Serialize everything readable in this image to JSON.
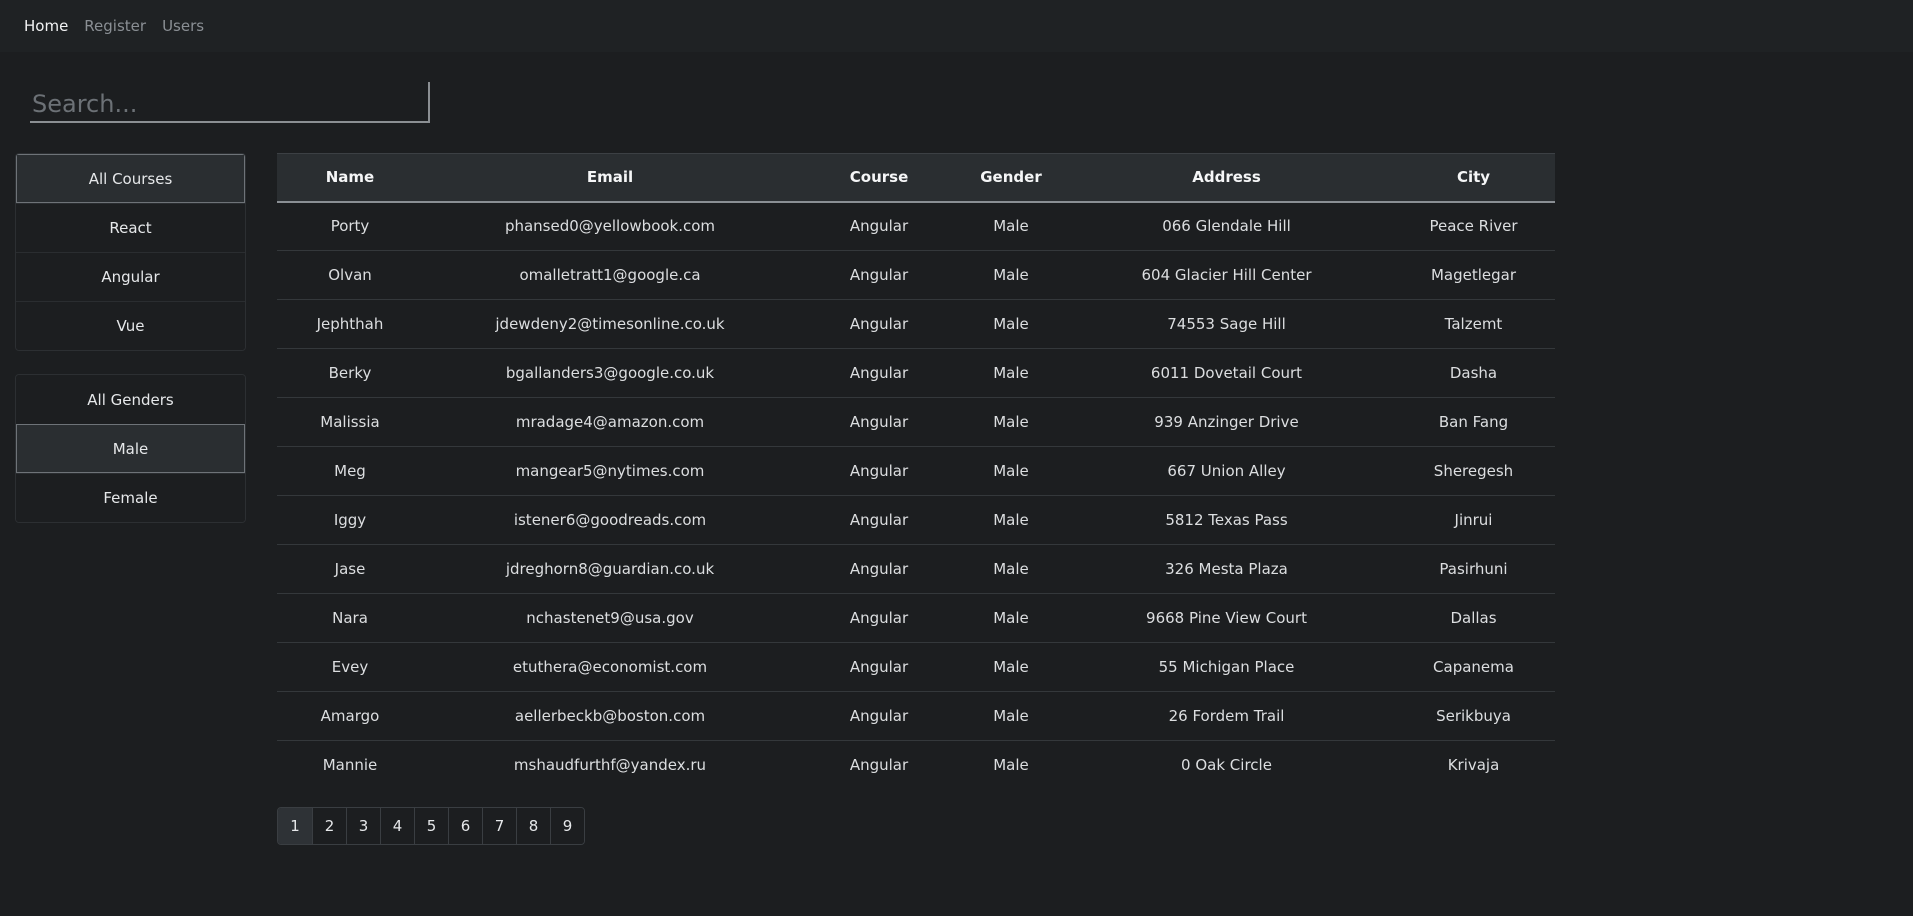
{
  "nav": {
    "items": [
      {
        "label": "Home",
        "active": true
      },
      {
        "label": "Register",
        "active": false
      },
      {
        "label": "Users",
        "active": false
      }
    ]
  },
  "search": {
    "placeholder": "Search...",
    "value": ""
  },
  "filters": {
    "courses": [
      {
        "label": "All Courses",
        "active": true
      },
      {
        "label": "React",
        "active": false
      },
      {
        "label": "Angular",
        "active": false
      },
      {
        "label": "Vue",
        "active": false
      }
    ],
    "genders": [
      {
        "label": "All Genders",
        "active": false
      },
      {
        "label": "Male",
        "active": true
      },
      {
        "label": "Female",
        "active": false
      }
    ]
  },
  "table": {
    "columns": [
      "Name",
      "Email",
      "Course",
      "Gender",
      "Address",
      "City"
    ],
    "rows": [
      [
        "Porty",
        "phansed0@yellowbook.com",
        "Angular",
        "Male",
        "066 Glendale Hill",
        "Peace River"
      ],
      [
        "Olvan",
        "omalletratt1@google.ca",
        "Angular",
        "Male",
        "604 Glacier Hill Center",
        "Magetlegar"
      ],
      [
        "Jephthah",
        "jdewdeny2@timesonline.co.uk",
        "Angular",
        "Male",
        "74553 Sage Hill",
        "Talzemt"
      ],
      [
        "Berky",
        "bgallanders3@google.co.uk",
        "Angular",
        "Male",
        "6011 Dovetail Court",
        "Dasha"
      ],
      [
        "Malissia",
        "mradage4@amazon.com",
        "Angular",
        "Male",
        "939 Anzinger Drive",
        "Ban Fang"
      ],
      [
        "Meg",
        "mangear5@nytimes.com",
        "Angular",
        "Male",
        "667 Union Alley",
        "Sheregesh"
      ],
      [
        "Iggy",
        "istener6@goodreads.com",
        "Angular",
        "Male",
        "5812 Texas Pass",
        "Jinrui"
      ],
      [
        "Jase",
        "jdreghorn8@guardian.co.uk",
        "Angular",
        "Male",
        "326 Mesta Plaza",
        "Pasirhuni"
      ],
      [
        "Nara",
        "nchastenet9@usa.gov",
        "Angular",
        "Male",
        "9668 Pine View Court",
        "Dallas"
      ],
      [
        "Evey",
        "etuthera@economist.com",
        "Angular",
        "Male",
        "55 Michigan Place",
        "Capanema"
      ],
      [
        "Amargo",
        "aellerbeckb@boston.com",
        "Angular",
        "Male",
        "26 Fordem Trail",
        "Serikbuya"
      ],
      [
        "Mannie",
        "mshaudfurthf@yandex.ru",
        "Angular",
        "Male",
        "0 Oak Circle",
        "Krivaja"
      ]
    ]
  },
  "pagination": {
    "pages": [
      "1",
      "2",
      "3",
      "4",
      "5",
      "6",
      "7",
      "8",
      "9"
    ],
    "current": "1"
  }
}
